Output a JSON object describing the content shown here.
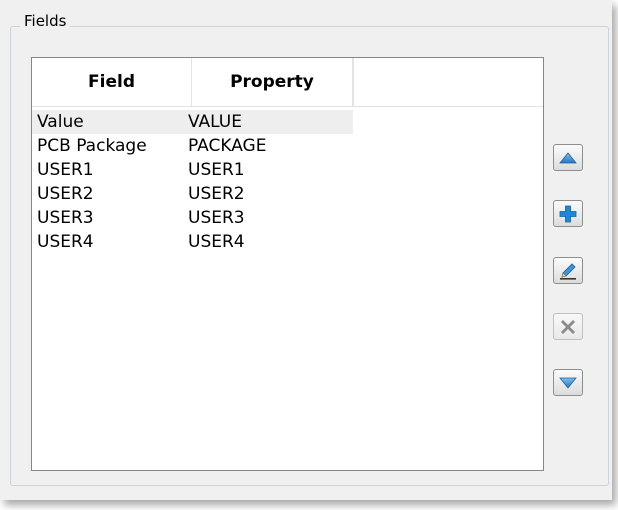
{
  "group": {
    "title": "Fields"
  },
  "table": {
    "columns": [
      "Field",
      "Property"
    ],
    "rows": [
      {
        "field": "Value",
        "property": "VALUE",
        "selected": true
      },
      {
        "field": "PCB Package",
        "property": "PACKAGE",
        "selected": false
      },
      {
        "field": "USER1",
        "property": "USER1",
        "selected": false
      },
      {
        "field": "USER2",
        "property": "USER2",
        "selected": false
      },
      {
        "field": "USER3",
        "property": "USER3",
        "selected": false
      },
      {
        "field": "USER4",
        "property": "USER4",
        "selected": false
      }
    ]
  },
  "buttons": [
    {
      "name": "move-up-button",
      "icon": "arrow-up-icon",
      "enabled": true
    },
    {
      "name": "add-field-button",
      "icon": "plus-icon",
      "enabled": true
    },
    {
      "name": "edit-field-button",
      "icon": "pencil-icon",
      "enabled": true
    },
    {
      "name": "delete-field-button",
      "icon": "x-icon",
      "enabled": false
    },
    {
      "name": "move-down-button",
      "icon": "arrow-down-icon",
      "enabled": true
    }
  ],
  "colors": {
    "accent": "#1e88d8",
    "arrow": "#3a8fd0",
    "disabled_icon": "#8a8a8a"
  }
}
